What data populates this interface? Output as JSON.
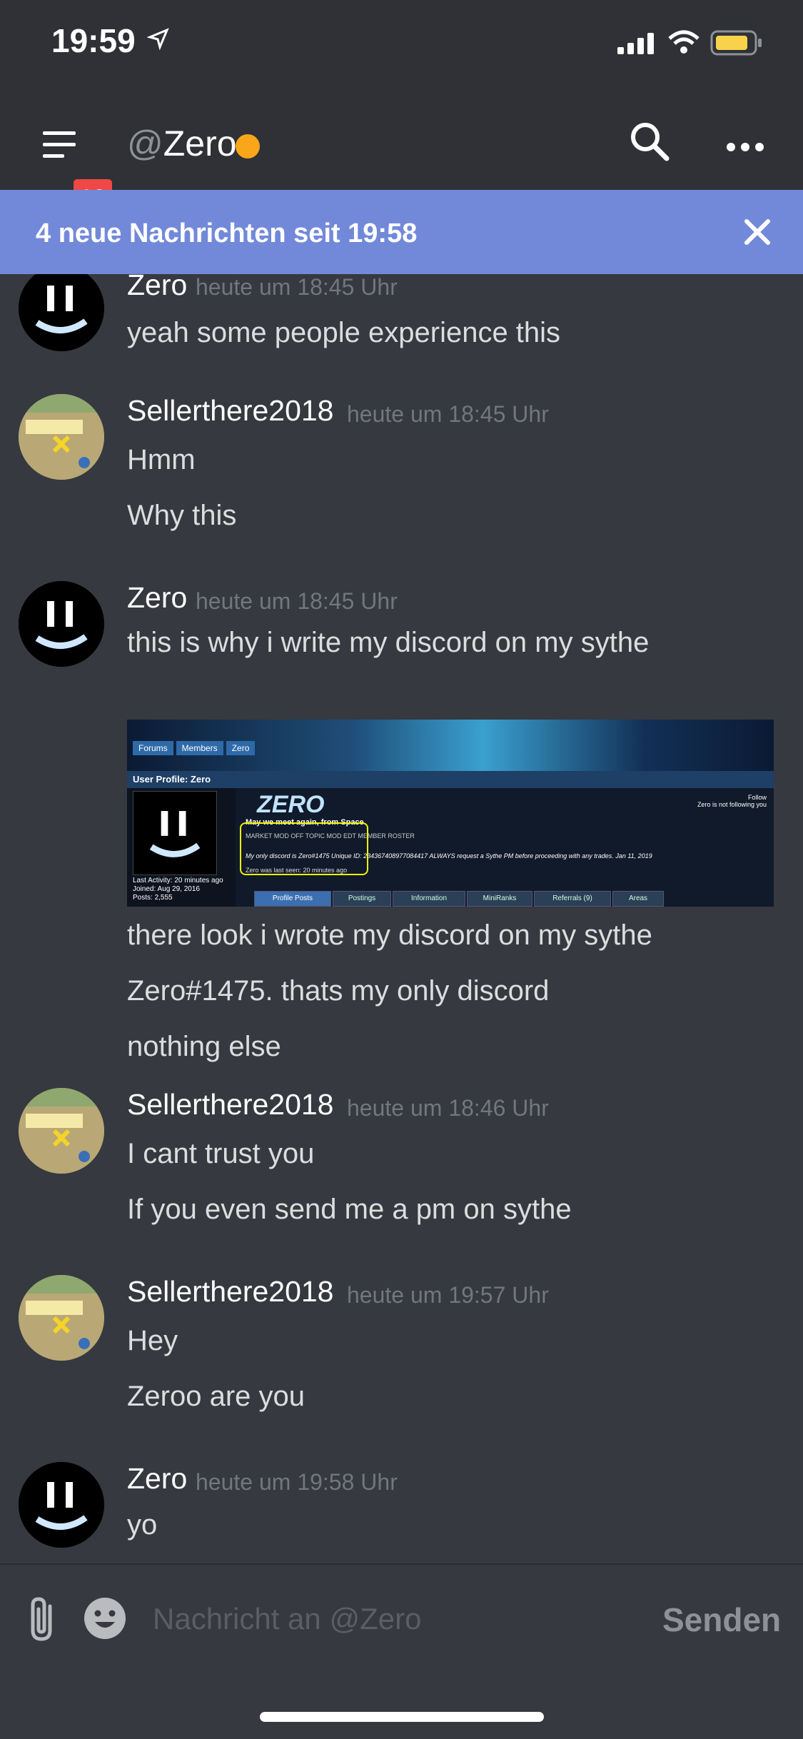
{
  "status_bar": {
    "time": "19:59"
  },
  "header": {
    "badge_count": "19",
    "at": "@",
    "channel": "Zero",
    "status_color": "#faa61a"
  },
  "banner": {
    "text": "4 neue Nachrichten seit 19:58"
  },
  "messages": [
    {
      "user": "Zero",
      "time": "heute um 18:45 Uhr",
      "lines": [
        "yeah some people experience this"
      ]
    },
    {
      "user": "Sellerthere2018",
      "time": "heute um 18:45 Uhr",
      "lines": [
        "Hmm",
        "Why this"
      ]
    },
    {
      "user": "Zero",
      "time": "heute um 18:45 Uhr",
      "lines": [
        "this is why i write my discord on my sythe"
      ],
      "after_image": [
        "there look i wrote my discord on my sythe",
        "Zero#1475. thats my only discord",
        "nothing else"
      ]
    },
    {
      "user": "Sellerthere2018",
      "time": "heute um 18:46 Uhr",
      "lines": [
        "I cant trust you",
        "If you even send me a pm on sythe"
      ]
    },
    {
      "user": "Sellerthere2018",
      "time": "heute um 19:57 Uhr",
      "lines": [
        "Hey",
        "Zeroo are you"
      ]
    },
    {
      "user": "Zero",
      "time": "heute um 19:58 Uhr",
      "lines": [
        "yo"
      ]
    }
  ],
  "embed": {
    "crumbs": [
      "Forums",
      "Members",
      "Zero"
    ],
    "profile_bar": "User Profile: Zero",
    "logo": "ZERO",
    "motto": "May we meet again, from Space",
    "follow": "Follow",
    "follow_note": "Zero is not following you",
    "ranks": "MARKET MOD   OFF TOPIC MOD   EDT MEMBER   ROSTER",
    "discord_line": "My only discord is Zero#1475 Unique ID: 234367408977084417 ALWAYS request a Sythe PM before proceeding with any trades.",
    "date": "Jan 11, 2019",
    "last_seen": "Zero was last seen: 20 minutes ago",
    "stats": [
      "Last Activity: 20 minutes ago",
      "Joined: Aug 29, 2016",
      "Posts: 2,555"
    ],
    "tabs": [
      "Profile Posts",
      "Postings",
      "Information",
      "MiniRanks",
      "Referrals (9)",
      "Areas"
    ]
  },
  "composer": {
    "placeholder": "Nachricht an @Zero",
    "send_label": "Senden"
  }
}
